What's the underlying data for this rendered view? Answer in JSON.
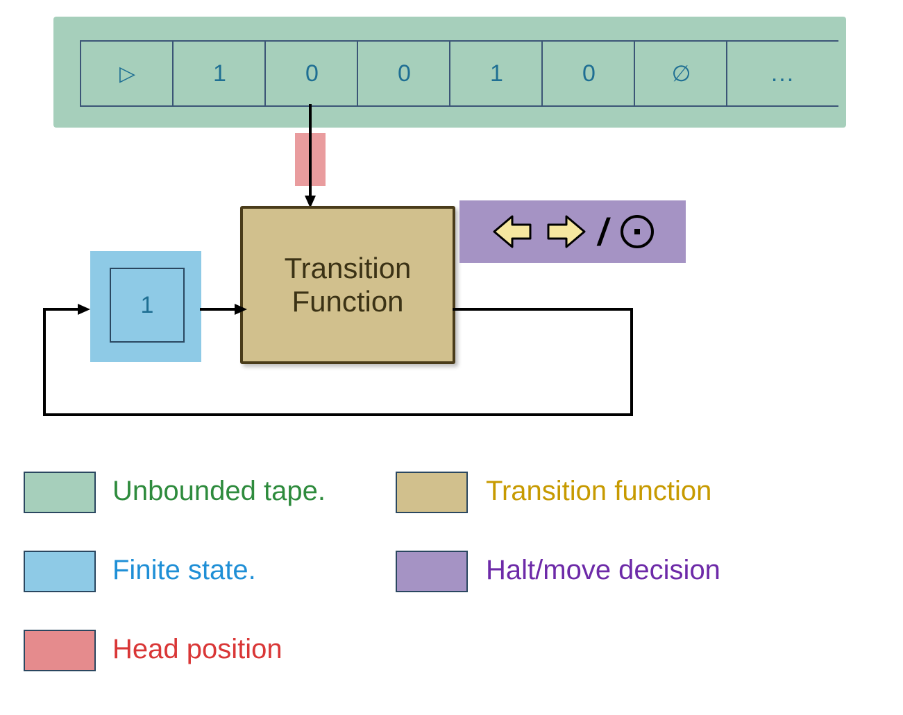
{
  "tape": {
    "cells": [
      "▷",
      "1",
      "0",
      "0",
      "1",
      "0",
      "∅",
      "..."
    ]
  },
  "state": {
    "value": "1"
  },
  "transition": {
    "label_line1": "Transition",
    "label_line2": "Function"
  },
  "halt_move": {
    "slash": "/"
  },
  "legend": {
    "tape": "Unbounded tape.",
    "state": "Finite state.",
    "head": "Head position",
    "transition": "Transition function",
    "haltmove": "Halt/move decision"
  },
  "colors": {
    "tape_fill": "#a6cfbb",
    "state_fill": "#8ecae6",
    "head_fill": "#e58b8d",
    "trans_fill": "#d1c08d",
    "hm_fill": "#a593c4",
    "tape_text": "#1f6f93",
    "legend_tape": "#2e8b3d",
    "legend_state": "#1f8fd6",
    "legend_head": "#d93636",
    "legend_trans": "#c79a00",
    "legend_hm": "#6d2aa8"
  }
}
